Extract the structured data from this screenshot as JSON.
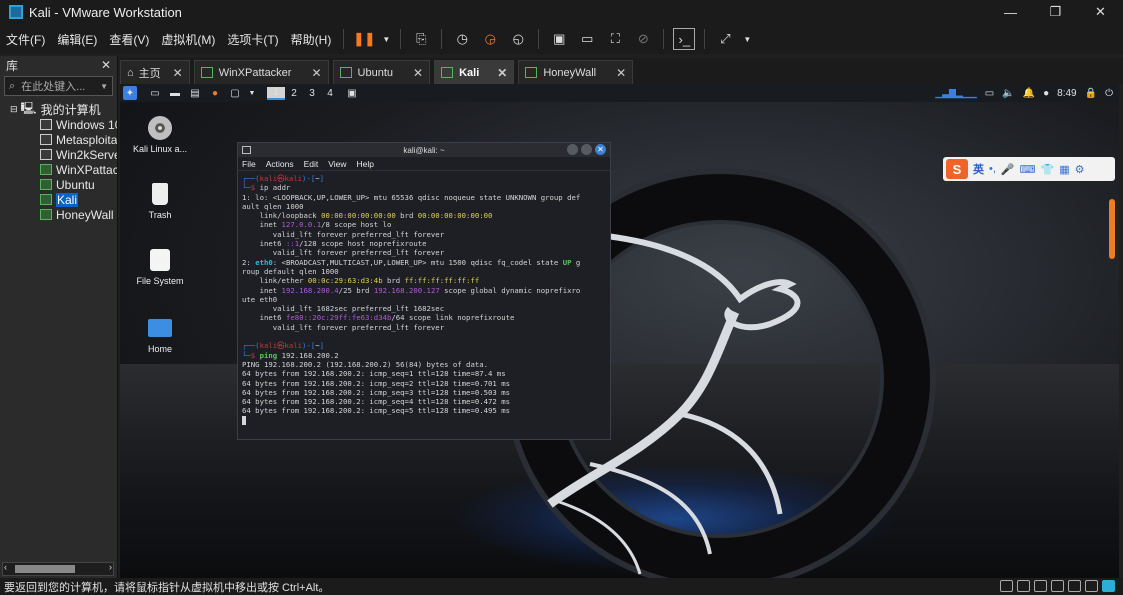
{
  "window": {
    "title": "Kali - VMware Workstation"
  },
  "menu": [
    "文件(F)",
    "编辑(E)",
    "查看(V)",
    "虚拟机(M)",
    "选项卡(T)",
    "帮助(H)"
  ],
  "library": {
    "title": "库",
    "search_placeholder": "在此处键入...",
    "root": "我的计算机",
    "vms": [
      {
        "name": "Windows 10",
        "running": false
      },
      {
        "name": "Metasploitable",
        "running": false
      },
      {
        "name": "Win2kServer",
        "running": false
      },
      {
        "name": "WinXPattacker",
        "running": true
      },
      {
        "name": "Ubuntu",
        "running": true
      },
      {
        "name": "Kali",
        "running": true,
        "selected": true
      },
      {
        "name": "HoneyWall",
        "running": true
      }
    ]
  },
  "tabs": [
    {
      "label": "主页",
      "active": false
    },
    {
      "label": "WinXPattacker",
      "active": false
    },
    {
      "label": "Ubuntu",
      "active": false
    },
    {
      "label": "Kali",
      "active": true
    },
    {
      "label": "HoneyWall",
      "active": false
    }
  ],
  "kali_panel": {
    "workspaces": [
      "1",
      "2",
      "3",
      "4"
    ],
    "current_workspace": "1",
    "clock": "8:49"
  },
  "desktop_icons": [
    {
      "label": "Kali Linux a...",
      "icon": "disc-icon"
    },
    {
      "label": "Trash",
      "icon": "trash-icon"
    },
    {
      "label": "File System",
      "icon": "drive-icon"
    },
    {
      "label": "Home",
      "icon": "home-folder-icon"
    }
  ],
  "terminal": {
    "title": "kali@kali: ~",
    "menu": [
      "File",
      "Actions",
      "Edit",
      "View",
      "Help"
    ],
    "lines": {
      "p1_user": "kali",
      "p1_host": "kali",
      "p1_path": "~",
      "cmd1": "ip addr",
      "l1": "1: lo: <LOOPBACK,UP,LOWER_UP> mtu 65536 qdisc noqueue state UNKNOWN group def",
      "l2": "ault qlen 1000",
      "l3_a": "    link/loopback ",
      "l3_mac": "00:00:00:00:00:00",
      "l3_b": " brd ",
      "l3_brd": "00:00:00:00:00:00",
      "l4_a": "    inet ",
      "l4_ip": "127.0.0.1",
      "l4_b": "/8 scope host lo",
      "l5": "       valid_lft forever preferred_lft forever",
      "l6_a": "    inet6 ",
      "l6_ip": "::1",
      "l6_b": "/128 scope host noprefixroute",
      "l7": "       valid_lft forever preferred_lft forever",
      "l8_a": "2: ",
      "l8_if": "eth0",
      "l8_b": ": <BROADCAST,MULTICAST,UP,LOWER_UP> mtu 1500 qdisc fq_codel state ",
      "l8_up": "UP",
      "l8_c": " g",
      "l9": "roup default qlen 1000",
      "l10_a": "    link/ether ",
      "l10_mac": "00:0c:29:63:d3:4b",
      "l10_b": " brd ",
      "l10_brd": "ff:ff:ff:ff:ff:ff",
      "l11_a": "    inet ",
      "l11_ip": "192.168.200.4",
      "l11_b": "/25 brd ",
      "l11_brd": "192.168.200.127",
      "l11_c": " scope global dynamic noprefixro",
      "l12": "ute eth0",
      "l13": "       valid_lft 1682sec preferred_lft 1682sec",
      "l14_a": "    inet6 ",
      "l14_ip": "fe80::20c:29ff:fe63:d34b",
      "l14_b": "/64 scope link noprefixroute",
      "l15": "       valid_lft forever preferred_lft forever",
      "cmd2_a": "ping",
      "cmd2_b": "192.168.200.2",
      "r0": "PING 192.168.200.2 (192.168.200.2) 56(84) bytes of data.",
      "r1": "64 bytes from 192.168.200.2: icmp_seq=1 ttl=128 time=87.4 ms",
      "r2": "64 bytes from 192.168.200.2: icmp_seq=2 ttl=128 time=0.701 ms",
      "r3": "64 bytes from 192.168.200.2: icmp_seq=3 ttl=128 time=0.503 ms",
      "r4": "64 bytes from 192.168.200.2: icmp_seq=4 ttl=128 time=0.472 ms",
      "r5": "64 bytes from 192.168.200.2: icmp_seq=5 ttl=128 time=0.495 ms"
    }
  },
  "ime": {
    "label": "英"
  },
  "statusbar": {
    "text": "要返回到您的计算机，请将鼠标指针从虚拟机中移出或按 Ctrl+Alt。"
  },
  "colors": {
    "accent": "#0a64c8",
    "kali_blue": "#3b7fe0",
    "running": "#59b35c"
  }
}
